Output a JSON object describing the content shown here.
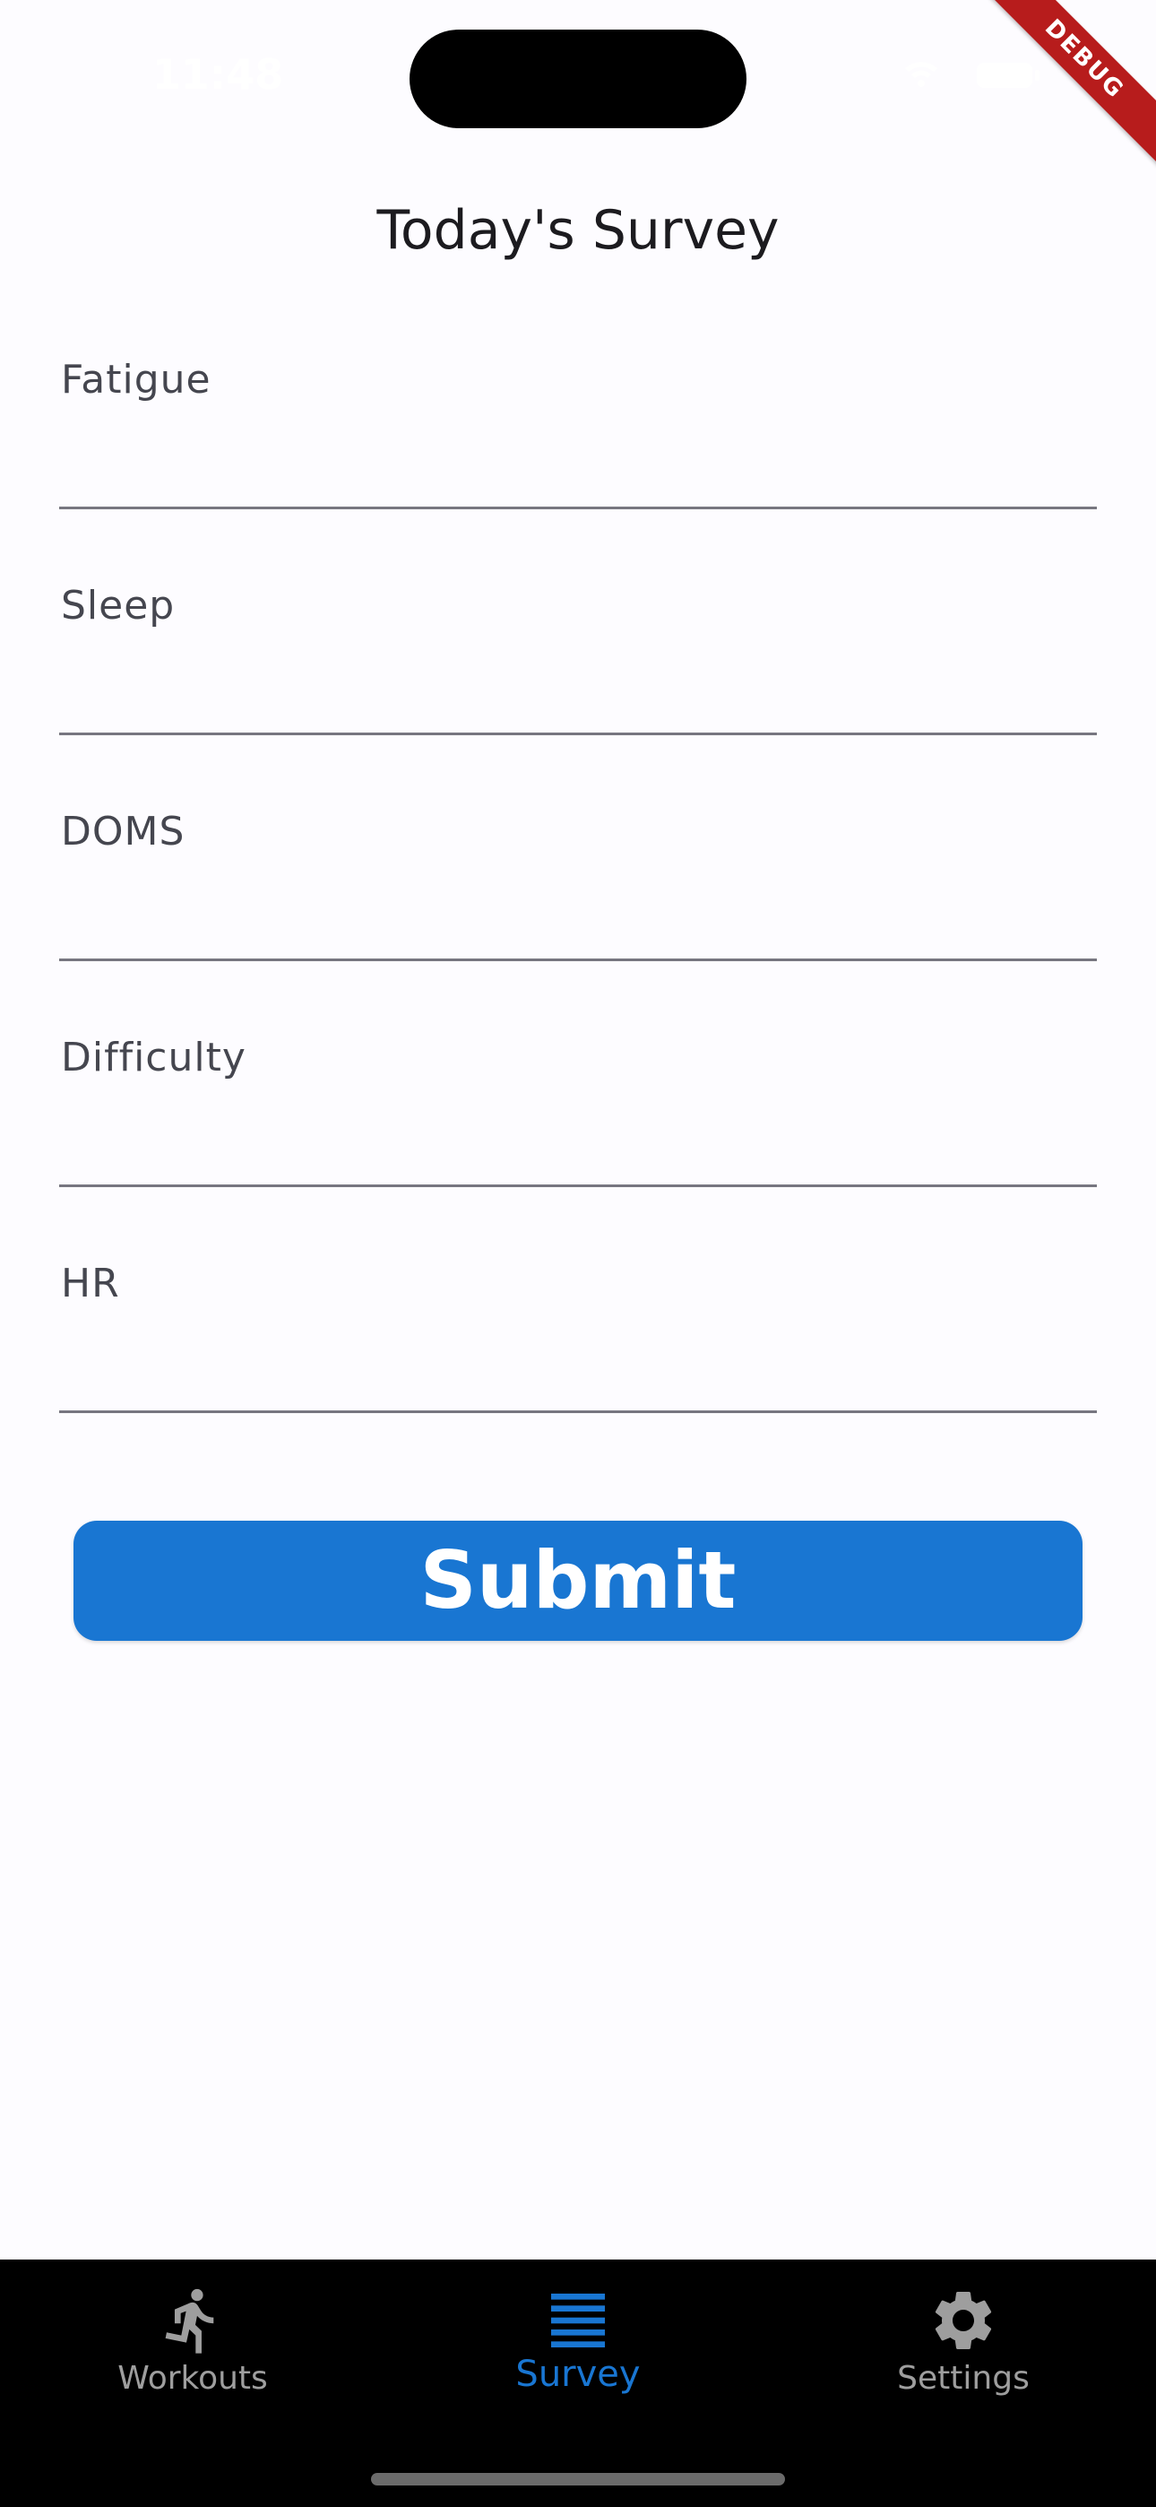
{
  "status_bar": {
    "time": "11:48"
  },
  "debug_banner": {
    "label": "DEBUG"
  },
  "page": {
    "title": "Today's Survey"
  },
  "form": {
    "fields": [
      {
        "label": "Fatigue"
      },
      {
        "label": "Sleep"
      },
      {
        "label": "DOMS"
      },
      {
        "label": "Difficulty"
      },
      {
        "label": "HR"
      }
    ],
    "submit_label": "Submit"
  },
  "bottom_nav": {
    "items": [
      {
        "label": "Workouts",
        "icon": "running-icon",
        "active": false
      },
      {
        "label": "Survey",
        "icon": "list-icon",
        "active": true
      },
      {
        "label": "Settings",
        "icon": "gear-icon",
        "active": false
      }
    ]
  },
  "colors": {
    "accent": "#1976d2",
    "background": "#fdfcff",
    "nav_background": "#000000",
    "inactive": "#9e9e9e",
    "debug_banner": "#b71c1c"
  }
}
